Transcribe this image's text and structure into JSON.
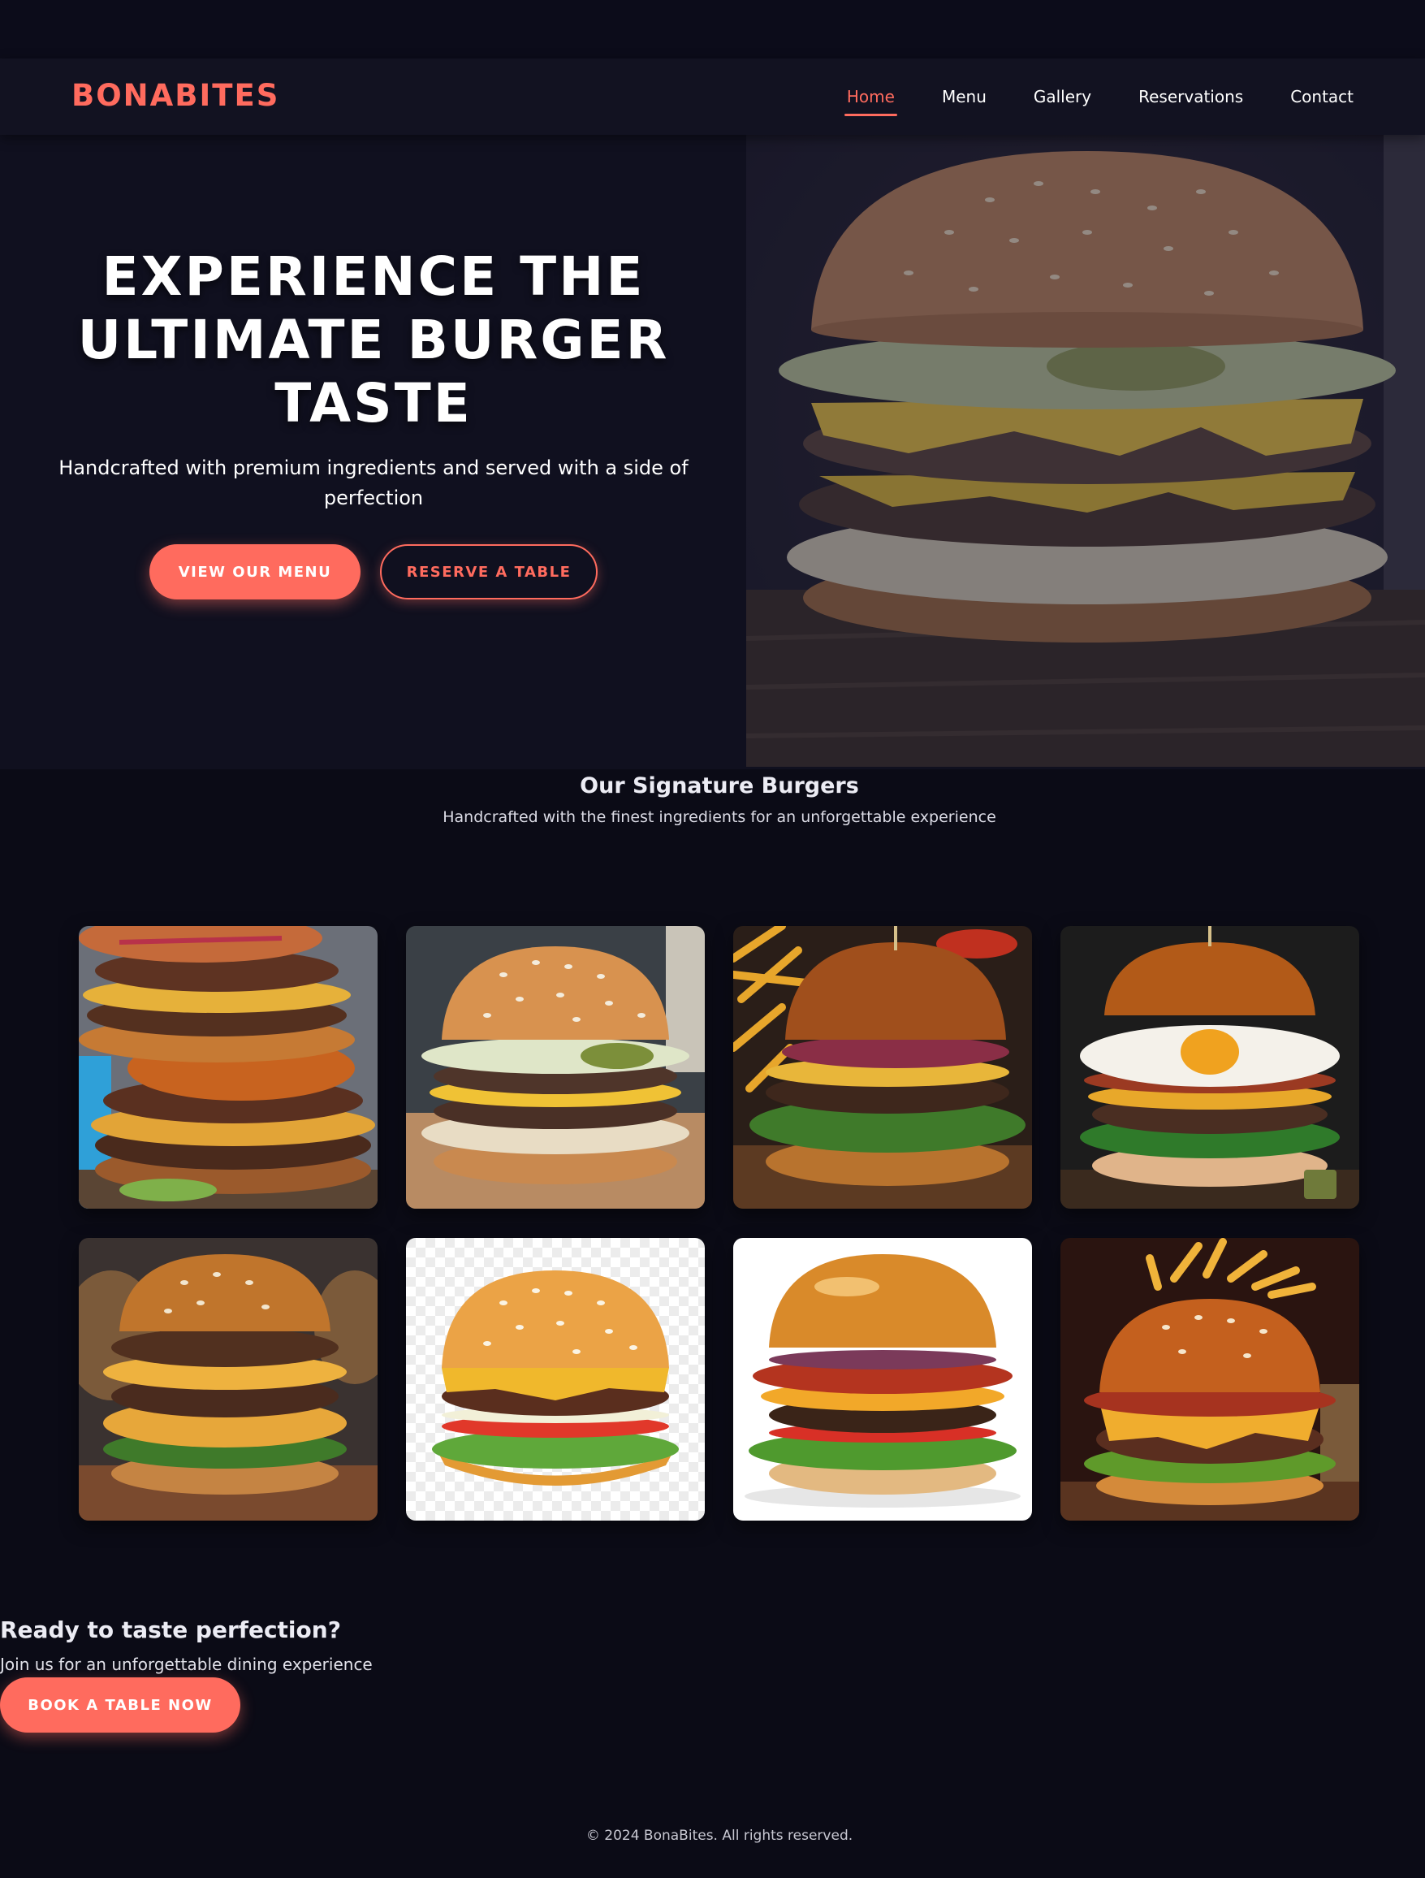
{
  "brand": {
    "name": "BONABITES",
    "accent": "#ff6b5e"
  },
  "nav": {
    "items": [
      {
        "label": "Home",
        "active": true
      },
      {
        "label": "Menu",
        "active": false
      },
      {
        "label": "Gallery",
        "active": false
      },
      {
        "label": "Reservations",
        "active": false
      },
      {
        "label": "Contact",
        "active": false
      }
    ]
  },
  "hero": {
    "title_lines": [
      "EXPERIENCE THE",
      "ULTIMATE BURGER",
      "TASTE"
    ],
    "subtitle_line1": "Handcrafted with premium ingredients and served with a side of",
    "subtitle_line2": "perfection",
    "primary_button": "VIEW OUR MENU",
    "secondary_button": "RESERVE A TABLE"
  },
  "signature": {
    "title": "Our Signature Burgers",
    "subtitle": "Handcrafted with the finest ingredients for an unforgettable experience",
    "gallery_count": 8
  },
  "cta": {
    "title": "Ready to taste perfection?",
    "subtitle": "Join us for an unforgettable dining experience",
    "button": "BOOK A TABLE NOW"
  },
  "footer": {
    "copyright": "© 2024 BonaBites. All rights reserved."
  },
  "colors": {
    "background": "#0b0b16",
    "navbar": "#121221",
    "hero_bg": "#10101f",
    "accent": "#ff6b5e",
    "text": "#ffffff"
  }
}
